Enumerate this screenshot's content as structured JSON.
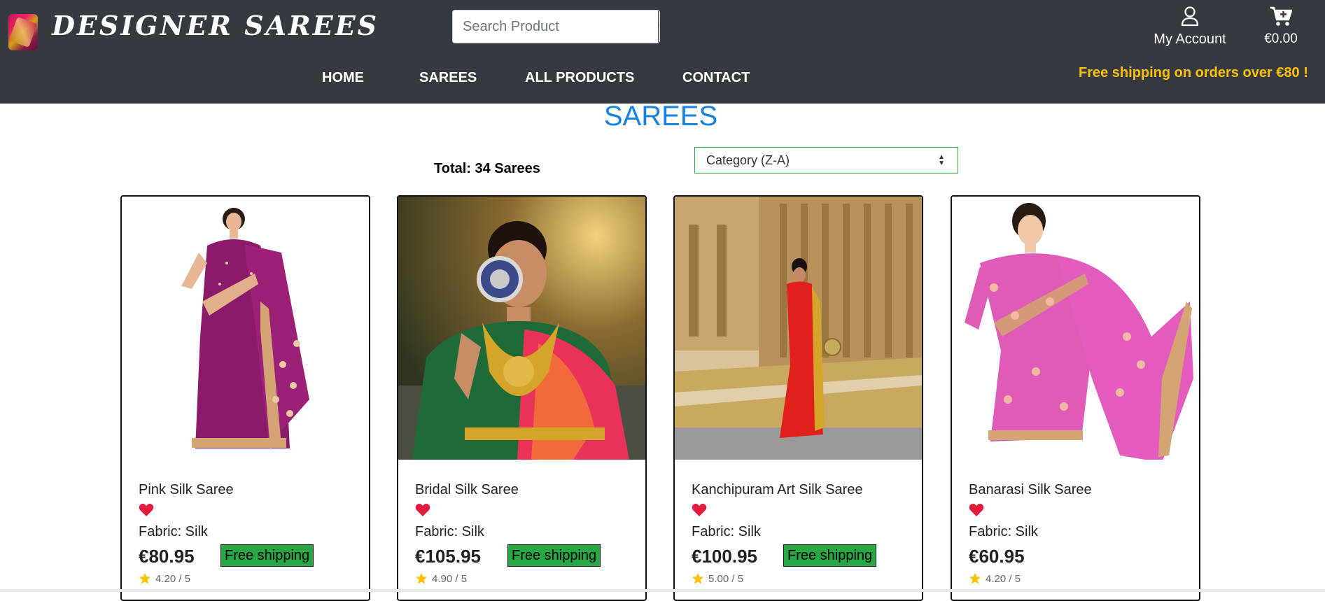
{
  "brand": {
    "name": "DESIGNER SAREES"
  },
  "search": {
    "placeholder": "Search Product"
  },
  "account": {
    "label": "My Account"
  },
  "cart": {
    "total": "€0.00"
  },
  "nav": [
    {
      "label": "HOME"
    },
    {
      "label": "SAREES"
    },
    {
      "label": "ALL PRODUCTS"
    },
    {
      "label": "CONTACT"
    }
  ],
  "promo": "Free shipping on orders over €80 !",
  "page": {
    "title": "SAREES",
    "total": "Total: 34 Sarees",
    "sort_selected": "Category (Z-A)"
  },
  "products": [
    {
      "name": "Pink Silk Saree",
      "fabric": "Fabric: Silk",
      "price": "€80.95",
      "shipping": "Free shipping",
      "rating": "4.20 / 5"
    },
    {
      "name": "Bridal Silk Saree",
      "fabric": "Fabric: Silk",
      "price": "€105.95",
      "shipping": "Free shipping",
      "rating": "4.90 / 5"
    },
    {
      "name": "Kanchipuram Art Silk Saree",
      "fabric": "Fabric: Silk",
      "price": "€100.95",
      "shipping": "Free shipping",
      "rating": "5.00 / 5"
    },
    {
      "name": "Banarasi Silk Saree",
      "fabric": "Fabric: Silk",
      "price": "€60.95",
      "shipping": "",
      "rating": "4.20 / 5"
    }
  ],
  "colors": {
    "header": "#343a40",
    "promo": "#ffc107",
    "title": "#1982e3",
    "shipping_badge": "#28a745",
    "heart": "#e31b3c",
    "star": "#ffc107"
  },
  "icons": {
    "search": "search-icon",
    "account": "user-icon",
    "cart": "cart-icon",
    "wishlist": "heart-icon",
    "rating": "star-icon"
  }
}
